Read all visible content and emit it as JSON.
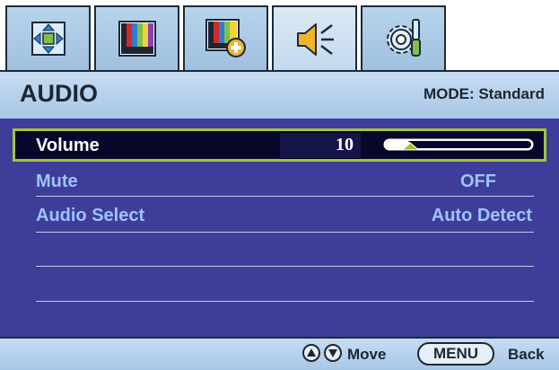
{
  "tabs": [
    {
      "icon": "display-position-icon",
      "active": false
    },
    {
      "icon": "picture-icon",
      "active": false
    },
    {
      "icon": "picture-advanced-icon",
      "active": false
    },
    {
      "icon": "audio-speaker-icon",
      "active": true
    },
    {
      "icon": "system-settings-icon",
      "active": false
    }
  ],
  "header": {
    "title": "AUDIO",
    "mode": "MODE: Standard"
  },
  "items": {
    "volume": {
      "label": "Volume",
      "value": "10"
    },
    "mute": {
      "label": "Mute",
      "value": "OFF"
    },
    "audio_select": {
      "label": "Audio Select",
      "value": "Auto Detect"
    }
  },
  "volume_slider": {
    "level": 0.1
  },
  "footer": {
    "move_label": "Move",
    "menu_label": "MENU",
    "back_label": "Back"
  },
  "colors": {
    "menu_bg": "#3e3d99",
    "selected_bg": "#07072b",
    "selected_border": "#a7c23a",
    "item_text": "#9ec3ff",
    "panel": "#b8d4ec"
  }
}
